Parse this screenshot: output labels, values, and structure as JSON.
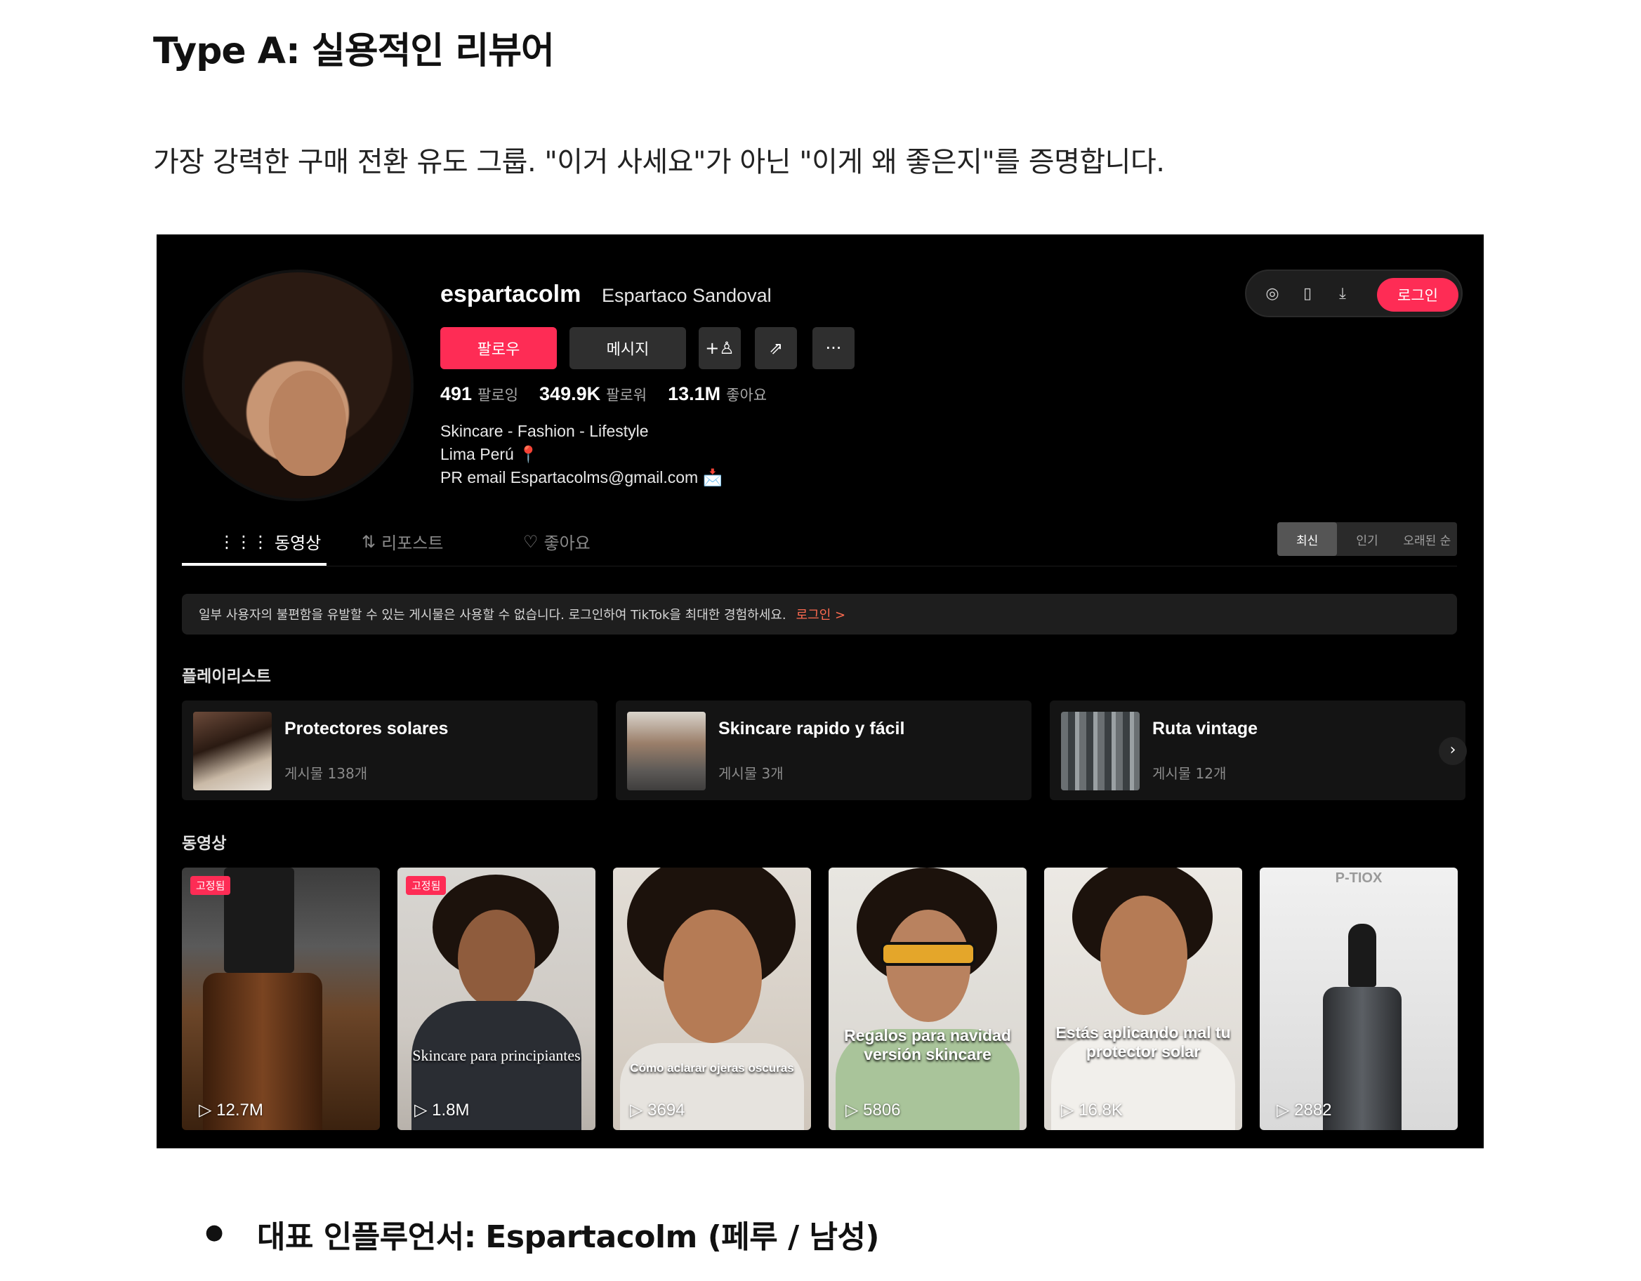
{
  "doc": {
    "title": "Type A: 실용적인 리뷰어",
    "intro": "가장 강력한 구매 전환 유도 그룹. \"이거 사세요\"가 아닌 \"이게 왜 좋은지\"를 증명합니다.",
    "bullet_label": "대표 인플루언서:",
    "bullet_value": "Espartacolm (페루 / 남성)"
  },
  "profile": {
    "username": "espartacolm",
    "nickname": "Espartaco Sandoval",
    "follow_label": "팔로우",
    "message_label": "메시지",
    "stats": [
      {
        "value": "491",
        "label": "팔로잉"
      },
      {
        "value": "349.9K",
        "label": "팔로워"
      },
      {
        "value": "13.1M",
        "label": "좋아요"
      }
    ],
    "bio": [
      "Skincare - Fashion - Lifestyle",
      "Lima Perú 📍",
      "PR email Espartacolms@gmail.com 📩"
    ],
    "login_label": "로그인"
  },
  "tabs": [
    {
      "icon": "⋮⋮⋮",
      "label": "동영상"
    },
    {
      "icon": "⇅",
      "label": "리포스트"
    },
    {
      "icon": "♡",
      "label": "좋아요"
    }
  ],
  "sort": [
    "최신",
    "인기",
    "오래된 순"
  ],
  "notice": {
    "text": "일부 사용자의 불편함을 유발할 수 있는 게시물은 사용할 수 없습니다. 로그인하여 TikTok을 최대한 경험하세요.",
    "link": "로그인 >"
  },
  "playlist_title": "플레이리스트",
  "playlists": [
    {
      "name": "Protectores solares",
      "count": "게시물 138개"
    },
    {
      "name": "Skincare rapido y fácil",
      "count": "게시물 3개"
    },
    {
      "name": "Ruta vintage",
      "count": "게시물 12개"
    }
  ],
  "videos_title": "동영상",
  "videos": [
    {
      "views": "12.7M",
      "pinned": "고정됨"
    },
    {
      "views": "1.8M",
      "pinned": "고정됨",
      "caption": "Skincare para principiantes"
    },
    {
      "views": "3694",
      "caption": "Cómo aclarar ojeras oscuras"
    },
    {
      "views": "5806",
      "caption": "Regalos para navidad versión skincare"
    },
    {
      "views": "16.8K",
      "caption": "Estás aplicando mal tu protector solar"
    },
    {
      "views": "2882",
      "caption": "P-TIOX"
    }
  ],
  "colors": {
    "accent": "#fe2c55",
    "background": "#000000"
  }
}
